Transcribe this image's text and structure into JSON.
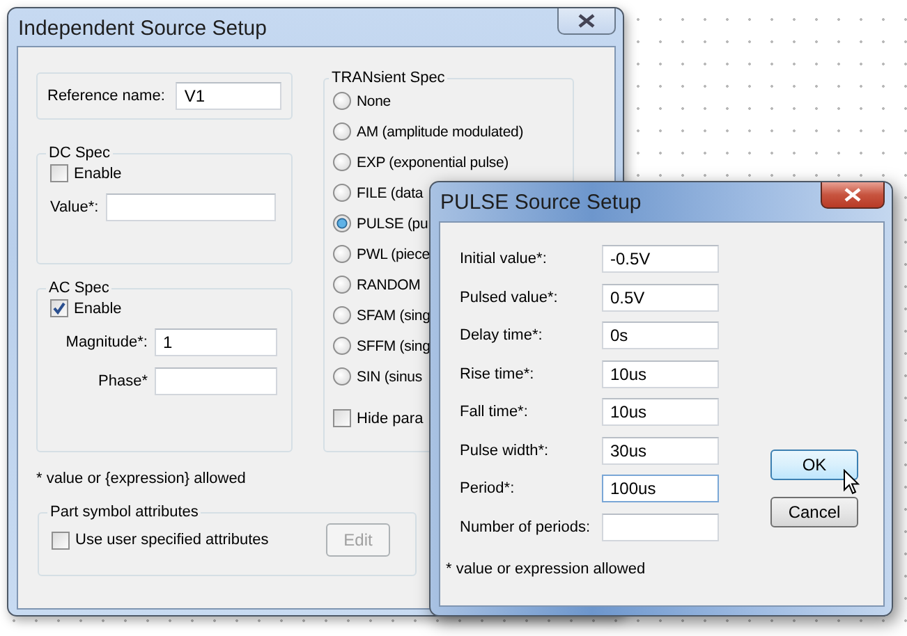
{
  "main_window": {
    "title": "Independent Source Setup",
    "reference_name": {
      "label": "Reference name:",
      "value": "V1"
    },
    "dc_spec": {
      "title": "DC Spec",
      "enable": {
        "label": "Enable",
        "checked": false
      },
      "value": {
        "label": "Value*:"
      }
    },
    "ac_spec": {
      "title": "AC Spec",
      "enable": {
        "label": "Enable",
        "checked": true
      },
      "magnitude": {
        "label": "Magnitude*:",
        "value": "1"
      },
      "phase": {
        "label": "Phase*"
      }
    },
    "footnote": "* value or {expression} allowed",
    "part_symbol": {
      "title": "Part symbol attributes",
      "checkbox": {
        "label": "Use user specified attributes",
        "checked": false
      },
      "edit_button": {
        "label": "Edit",
        "disabled": true
      }
    },
    "transient_spec": {
      "title": "TRANsient Spec",
      "options": [
        {
          "label": "None",
          "selected": false
        },
        {
          "label": "AM (amplitude modulated)",
          "selected": false
        },
        {
          "label": "EXP (exponential pulse)",
          "selected": false
        },
        {
          "label": "FILE (data",
          "selected": false
        },
        {
          "label": "PULSE (pu",
          "selected": true
        },
        {
          "label": "PWL (piece",
          "selected": false
        },
        {
          "label": "RANDOM",
          "selected": false
        },
        {
          "label": "SFAM (sing",
          "selected": false
        },
        {
          "label": "SFFM (sing",
          "selected": false
        },
        {
          "label": "SIN (sinus",
          "selected": false
        }
      ],
      "hide_params": {
        "label": "Hide para",
        "checked": false
      }
    }
  },
  "pulse_dialog": {
    "title": "PULSE Source Setup",
    "fields": [
      {
        "label": "Initial value*:",
        "value": "-0.5V",
        "focused": false
      },
      {
        "label": "Pulsed value*:",
        "value": "0.5V",
        "focused": false
      },
      {
        "label": "Delay time*:",
        "value": "0s",
        "focused": false
      },
      {
        "label": "Rise time*:",
        "value": "10us",
        "focused": false
      },
      {
        "label": "Fall time*:",
        "value": "10us",
        "focused": false
      },
      {
        "label": "Pulse width*:",
        "value": "30us",
        "focused": false
      },
      {
        "label": "Period*:",
        "value": "100us",
        "focused": true
      },
      {
        "label": "Number of periods:",
        "focused": false
      }
    ],
    "buttons": [
      {
        "label": "OK",
        "hovered": true
      },
      {
        "label": "Cancel",
        "hovered": false
      }
    ],
    "footnote": "* value or expression allowed"
  }
}
